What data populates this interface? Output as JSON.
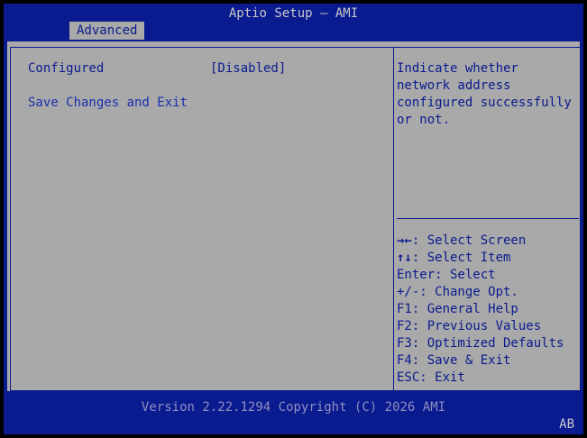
{
  "header": {
    "title": "Aptio Setup – AMI"
  },
  "tabs": [
    {
      "label": "Advanced"
    }
  ],
  "settings": {
    "configured": {
      "label": "Configured",
      "value": "[Disabled]"
    },
    "save_exit": {
      "label": "Save Changes and Exit"
    }
  },
  "help": {
    "text": "Indicate whether\nnetwork address\nconfigured successfully\nor not."
  },
  "keys": [
    {
      "key": "→←",
      "text": ": Select Screen"
    },
    {
      "key": "↑↓",
      "text": ": Select Item"
    },
    {
      "key": "",
      "text": "Enter: Select"
    },
    {
      "key": "",
      "text": "+/-: Change Opt."
    },
    {
      "key": "",
      "text": "F1: General Help"
    },
    {
      "key": "",
      "text": "F2: Previous Values"
    },
    {
      "key": "",
      "text": "F3: Optimized Defaults"
    },
    {
      "key": "",
      "text": "F4: Save & Exit"
    },
    {
      "key": "",
      "text": "ESC: Exit"
    }
  ],
  "footer": {
    "version": "Version 2.22.1294 Copyright (C) 2026 AMI",
    "indicator": "AB"
  },
  "colors": {
    "frame_blue": "#0a1a8f",
    "panel_gray": "#a9a9a9",
    "title_text": "#c8c8c8"
  }
}
